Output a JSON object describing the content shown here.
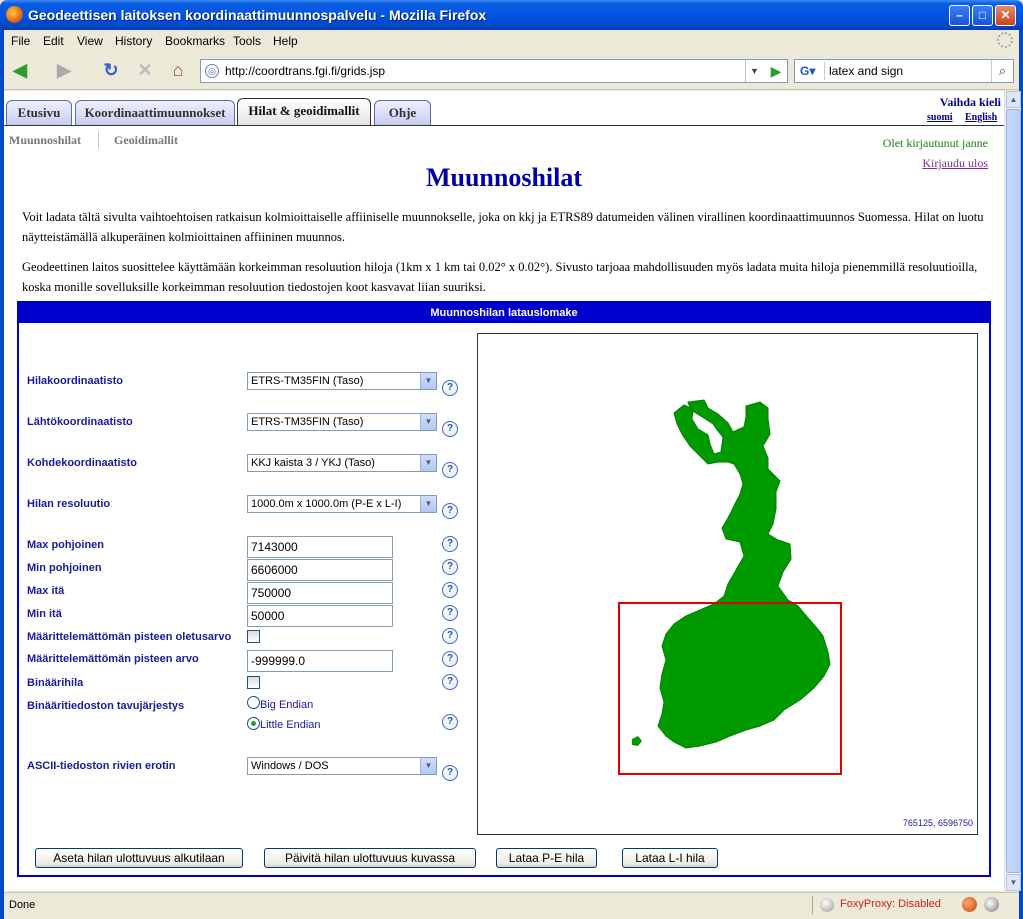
{
  "window": {
    "title": "Geodeettisen laitoksen koordinaattimuunnospalvelu - Mozilla Firefox"
  },
  "menu": [
    "File",
    "Edit",
    "View",
    "History",
    "Bookmarks",
    "Tools",
    "Help"
  ],
  "toolbar": {
    "url": "http://coordtrans.fgi.fi/grids.jsp",
    "search_value": "latex and sign"
  },
  "tabs": [
    "Etusivu",
    "Koordinaattimuunnokset",
    "Hilat & geoidimallit",
    "Ohje"
  ],
  "active_tab": "Hilat & geoidimallit",
  "subnav": [
    "Muunnoshilat",
    "Geoidimallit"
  ],
  "lang": {
    "title": "Vaihda kieli",
    "fi": "suomi",
    "en": "English"
  },
  "user": {
    "status": "Olet kirjautunut janne",
    "logout": "Kirjaudu ulos"
  },
  "page": {
    "heading": "Muunnoshilat",
    "para1": "Voit ladata tältä sivulta vaihtoehtoisen ratkaisun kolmioittaiselle affiiniselle muunnokselle, joka on kkj ja ETRS89 datumeiden välinen virallinen koordinaattimuunnos Suomessa. Hilat on luotu näytteistämällä alkuperäinen kolmioittainen affiininen muunnos.",
    "para2": "Geodeettinen laitos suosittelee käyttämään korkeimman resoluution hiloja (1km x 1 km tai 0.02° x 0.02°). Sivusto tarjoaa mahdollisuuden myös ladata muita hiloja pienemmillä resoluutioilla, koska monille sovelluksille korkeimman resoluution tiedostojen koot kasvavat liian suuriksi."
  },
  "form": {
    "title": "Muunnoshilan latauslomake",
    "grid_crs": {
      "label": "Hilakoordinaatisto",
      "value": "ETRS-TM35FIN (Taso)"
    },
    "source_crs": {
      "label": "Lähtökoordinaatisto",
      "value": "ETRS-TM35FIN (Taso)"
    },
    "target_crs": {
      "label": "Kohdekoordinaatisto",
      "value": "KKJ kaista 3 / YKJ (Taso)"
    },
    "resolution": {
      "label": "Hilan resoluutio",
      "value": "1000.0m x 1000.0m (P-E x L-I)"
    },
    "max_north": {
      "label": "Max pohjoinen",
      "value": "7143000"
    },
    "min_north": {
      "label": "Min pohjoinen",
      "value": "6606000"
    },
    "max_east": {
      "label": "Max itä",
      "value": "750000"
    },
    "min_east": {
      "label": "Min itä",
      "value": "50000"
    },
    "nodata_default": {
      "label": "Määrittelemättömän pisteen oletusarvo",
      "checked": false
    },
    "nodata_value": {
      "label": "Määrittelemättömän pisteen arvo",
      "value": "-999999.0"
    },
    "binary": {
      "label": "Binäärihila",
      "checked": false
    },
    "byte_order": {
      "label": "Binääritiedoston tavujärjestys",
      "options": [
        "Big Endian",
        "Little Endian"
      ],
      "selected": "Little Endian"
    },
    "line_sep": {
      "label": "ASCII-tiedoston rivien erotin",
      "value": "Windows / DOS"
    },
    "map_coord": "765125, 6596750",
    "buttons": {
      "reset": "Aseta hilan ulottuvuus alkutilaan",
      "update": "Päivitä hilan ulottuvuus kuvassa",
      "load_pe": "Lataa P-E hila",
      "load_li": "Lataa L-I hila"
    }
  },
  "status": {
    "text": "Done",
    "foxyproxy": "FoxyProxy: Disabled"
  },
  "colors": {
    "map_land": "#009900",
    "selection": "#e00000",
    "form_header": "#0000cc",
    "heading": "#0000a8"
  }
}
